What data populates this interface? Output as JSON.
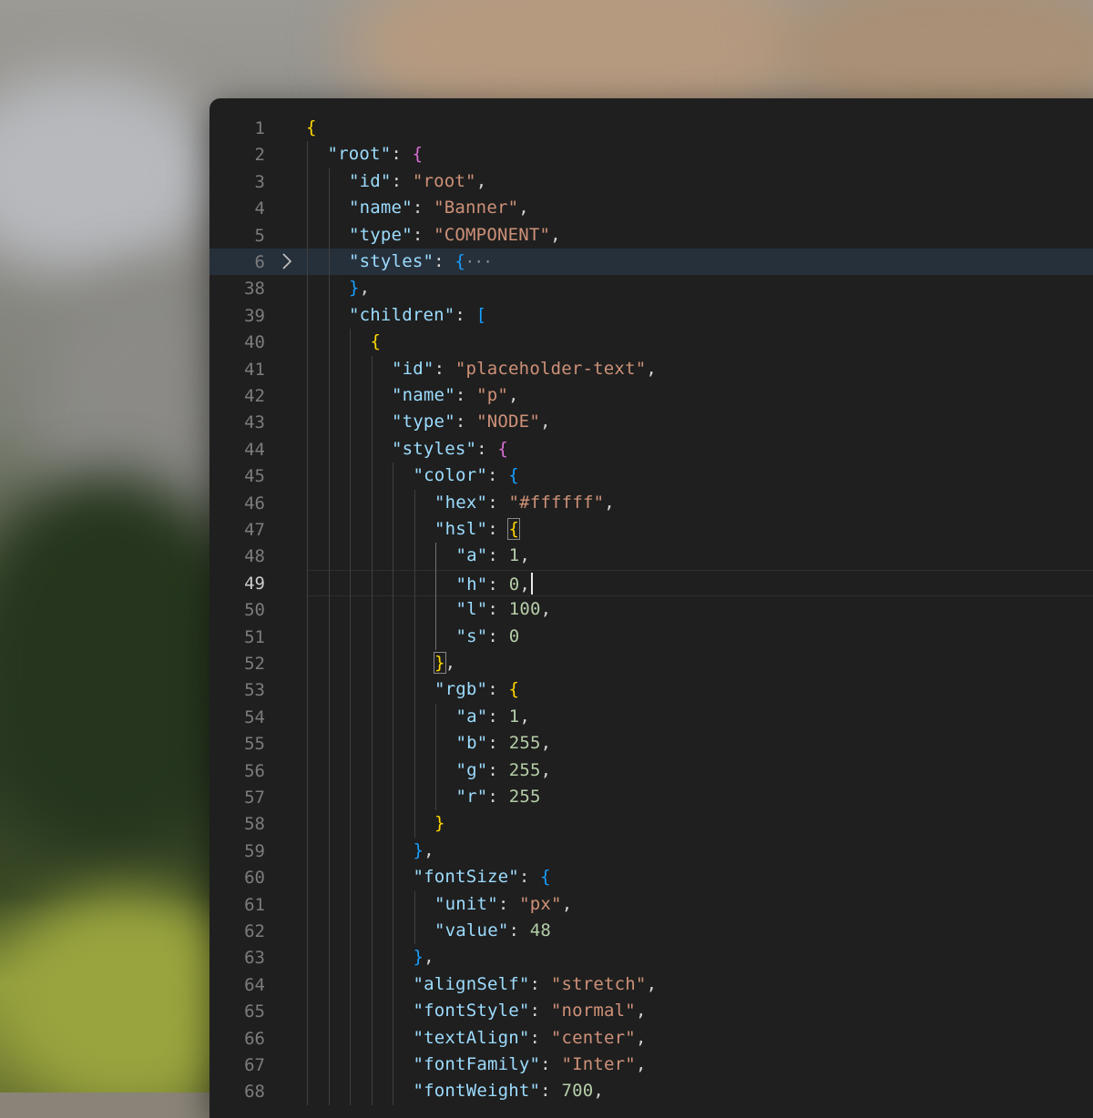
{
  "editor": {
    "language": "json",
    "cursor_line": "49",
    "folded_line": "6",
    "lines": [
      {
        "no": "1",
        "indent": 0,
        "tokens": [
          [
            "b1",
            "{"
          ]
        ]
      },
      {
        "no": "2",
        "indent": 1,
        "tokens": [
          [
            "k",
            "\"root\""
          ],
          [
            "p",
            ": "
          ],
          [
            "b2",
            "{"
          ]
        ]
      },
      {
        "no": "3",
        "indent": 2,
        "tokens": [
          [
            "k",
            "\"id\""
          ],
          [
            "p",
            ": "
          ],
          [
            "s",
            "\"root\""
          ],
          [
            "p",
            ","
          ]
        ]
      },
      {
        "no": "4",
        "indent": 2,
        "tokens": [
          [
            "k",
            "\"name\""
          ],
          [
            "p",
            ": "
          ],
          [
            "s",
            "\"Banner\""
          ],
          [
            "p",
            ","
          ]
        ]
      },
      {
        "no": "5",
        "indent": 2,
        "tokens": [
          [
            "k",
            "\"type\""
          ],
          [
            "p",
            ": "
          ],
          [
            "s",
            "\"COMPONENT\""
          ],
          [
            "p",
            ","
          ]
        ]
      },
      {
        "no": "6",
        "indent": 2,
        "tokens": [
          [
            "k",
            "\"styles\""
          ],
          [
            "p",
            ": "
          ],
          [
            "b3",
            "{"
          ],
          [
            "ell",
            "···"
          ]
        ]
      },
      {
        "no": "38",
        "indent": 2,
        "tokens": [
          [
            "b3",
            "}"
          ],
          [
            "p",
            ","
          ]
        ]
      },
      {
        "no": "39",
        "indent": 2,
        "tokens": [
          [
            "k",
            "\"children\""
          ],
          [
            "p",
            ": "
          ],
          [
            "b3",
            "["
          ]
        ]
      },
      {
        "no": "40",
        "indent": 3,
        "tokens": [
          [
            "b1",
            "{"
          ]
        ]
      },
      {
        "no": "41",
        "indent": 4,
        "tokens": [
          [
            "k",
            "\"id\""
          ],
          [
            "p",
            ": "
          ],
          [
            "s",
            "\"placeholder-text\""
          ],
          [
            "p",
            ","
          ]
        ]
      },
      {
        "no": "42",
        "indent": 4,
        "tokens": [
          [
            "k",
            "\"name\""
          ],
          [
            "p",
            ": "
          ],
          [
            "s",
            "\"p\""
          ],
          [
            "p",
            ","
          ]
        ]
      },
      {
        "no": "43",
        "indent": 4,
        "tokens": [
          [
            "k",
            "\"type\""
          ],
          [
            "p",
            ": "
          ],
          [
            "s",
            "\"NODE\""
          ],
          [
            "p",
            ","
          ]
        ]
      },
      {
        "no": "44",
        "indent": 4,
        "tokens": [
          [
            "k",
            "\"styles\""
          ],
          [
            "p",
            ": "
          ],
          [
            "b2",
            "{"
          ]
        ]
      },
      {
        "no": "45",
        "indent": 5,
        "tokens": [
          [
            "k",
            "\"color\""
          ],
          [
            "p",
            ": "
          ],
          [
            "b3",
            "{"
          ]
        ]
      },
      {
        "no": "46",
        "indent": 6,
        "tokens": [
          [
            "k",
            "\"hex\""
          ],
          [
            "p",
            ": "
          ],
          [
            "s",
            "\"#ffffff\""
          ],
          [
            "p",
            ","
          ]
        ]
      },
      {
        "no": "47",
        "indent": 6,
        "tokens": [
          [
            "k",
            "\"hsl\""
          ],
          [
            "p",
            ": "
          ],
          [
            "b1m",
            "{"
          ]
        ]
      },
      {
        "no": "48",
        "indent": 7,
        "tokens": [
          [
            "k",
            "\"a\""
          ],
          [
            "p",
            ": "
          ],
          [
            "n",
            "1"
          ],
          [
            "p",
            ","
          ]
        ]
      },
      {
        "no": "49",
        "indent": 7,
        "tokens": [
          [
            "k",
            "\"h\""
          ],
          [
            "p",
            ": "
          ],
          [
            "n",
            "0"
          ],
          [
            "p",
            ","
          ],
          [
            "caret",
            ""
          ]
        ]
      },
      {
        "no": "50",
        "indent": 7,
        "tokens": [
          [
            "k",
            "\"l\""
          ],
          [
            "p",
            ": "
          ],
          [
            "n",
            "100"
          ],
          [
            "p",
            ","
          ]
        ]
      },
      {
        "no": "51",
        "indent": 7,
        "tokens": [
          [
            "k",
            "\"s\""
          ],
          [
            "p",
            ": "
          ],
          [
            "n",
            "0"
          ]
        ]
      },
      {
        "no": "52",
        "indent": 6,
        "tokens": [
          [
            "b1m",
            "}"
          ],
          [
            "p",
            ","
          ]
        ]
      },
      {
        "no": "53",
        "indent": 6,
        "tokens": [
          [
            "k",
            "\"rgb\""
          ],
          [
            "p",
            ": "
          ],
          [
            "b1",
            "{"
          ]
        ]
      },
      {
        "no": "54",
        "indent": 7,
        "tokens": [
          [
            "k",
            "\"a\""
          ],
          [
            "p",
            ": "
          ],
          [
            "n",
            "1"
          ],
          [
            "p",
            ","
          ]
        ]
      },
      {
        "no": "55",
        "indent": 7,
        "tokens": [
          [
            "k",
            "\"b\""
          ],
          [
            "p",
            ": "
          ],
          [
            "n",
            "255"
          ],
          [
            "p",
            ","
          ]
        ]
      },
      {
        "no": "56",
        "indent": 7,
        "tokens": [
          [
            "k",
            "\"g\""
          ],
          [
            "p",
            ": "
          ],
          [
            "n",
            "255"
          ],
          [
            "p",
            ","
          ]
        ]
      },
      {
        "no": "57",
        "indent": 7,
        "tokens": [
          [
            "k",
            "\"r\""
          ],
          [
            "p",
            ": "
          ],
          [
            "n",
            "255"
          ]
        ]
      },
      {
        "no": "58",
        "indent": 6,
        "tokens": [
          [
            "b1",
            "}"
          ]
        ]
      },
      {
        "no": "59",
        "indent": 5,
        "tokens": [
          [
            "b3",
            "}"
          ],
          [
            "p",
            ","
          ]
        ]
      },
      {
        "no": "60",
        "indent": 5,
        "tokens": [
          [
            "k",
            "\"fontSize\""
          ],
          [
            "p",
            ": "
          ],
          [
            "b3",
            "{"
          ]
        ]
      },
      {
        "no": "61",
        "indent": 6,
        "tokens": [
          [
            "k",
            "\"unit\""
          ],
          [
            "p",
            ": "
          ],
          [
            "s",
            "\"px\""
          ],
          [
            "p",
            ","
          ]
        ]
      },
      {
        "no": "62",
        "indent": 6,
        "tokens": [
          [
            "k",
            "\"value\""
          ],
          [
            "p",
            ": "
          ],
          [
            "n",
            "48"
          ]
        ]
      },
      {
        "no": "63",
        "indent": 5,
        "tokens": [
          [
            "b3",
            "}"
          ],
          [
            "p",
            ","
          ]
        ]
      },
      {
        "no": "64",
        "indent": 5,
        "tokens": [
          [
            "k",
            "\"alignSelf\""
          ],
          [
            "p",
            ": "
          ],
          [
            "s",
            "\"stretch\""
          ],
          [
            "p",
            ","
          ]
        ]
      },
      {
        "no": "65",
        "indent": 5,
        "tokens": [
          [
            "k",
            "\"fontStyle\""
          ],
          [
            "p",
            ": "
          ],
          [
            "s",
            "\"normal\""
          ],
          [
            "p",
            ","
          ]
        ]
      },
      {
        "no": "66",
        "indent": 5,
        "tokens": [
          [
            "k",
            "\"textAlign\""
          ],
          [
            "p",
            ": "
          ],
          [
            "s",
            "\"center\""
          ],
          [
            "p",
            ","
          ]
        ]
      },
      {
        "no": "67",
        "indent": 5,
        "tokens": [
          [
            "k",
            "\"fontFamily\""
          ],
          [
            "p",
            ": "
          ],
          [
            "s",
            "\"Inter\""
          ],
          [
            "p",
            ","
          ]
        ]
      },
      {
        "no": "68",
        "indent": 5,
        "tokens": [
          [
            "k",
            "\"fontWeight\""
          ],
          [
            "p",
            ": "
          ],
          [
            "n",
            "700"
          ],
          [
            "p",
            ","
          ]
        ]
      }
    ]
  },
  "colors": {
    "background": "#1f1f1f",
    "key": "#9cdcfe",
    "string": "#ce9178",
    "number": "#b5cea8",
    "bracket_gold": "#ffd700",
    "bracket_orchid": "#da70d6",
    "bracket_blue": "#179fff"
  }
}
